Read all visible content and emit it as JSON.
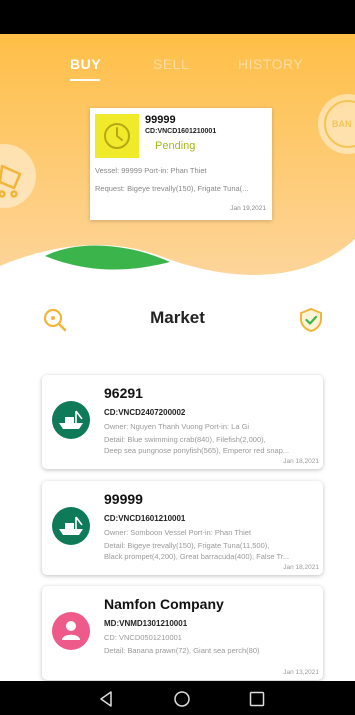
{
  "tabs": [
    {
      "label": "BUY"
    },
    {
      "label": "SELL"
    },
    {
      "label": "HISTORY"
    }
  ],
  "colors": {
    "gradient_top": "#ffc04a",
    "gradient_bottom": "#fdd28a",
    "accent_green": "#3cb44c",
    "pending_yellow": "#f1ea2a",
    "status_text": "#a6b81a",
    "icon_orange": "#f3b43a",
    "vessel_avatar": "#0e7a57",
    "company_avatar": "#ee5a8a"
  },
  "order": {
    "title": "99999",
    "code": "CD:VNCD1601210001",
    "status": "Pending",
    "vessel": "Vessel: 99999  Port-in: Phan Thiet",
    "request": "Request: Bigeye trevally(150), Frigate Tuna(...",
    "date": "Jan 19,2021",
    "icon": "clock-icon"
  },
  "side_badge_right": {
    "text": "BAN"
  },
  "market": {
    "title": "Market",
    "search_icon": "search-icon",
    "shield_icon": "shield-check-icon"
  },
  "listings": [
    {
      "title": "96291",
      "code": "CD:VNCD2407200002",
      "line1": "Owner: Nguyen Thanh Vuong  Port-in: La Gi",
      "line2": "Detail: Blue swimming crab(840), Filefish(2,000),",
      "line3": "Deep sea pungnose ponyfish(565), Emperor red snap...",
      "date": "Jan 18,2021",
      "icon": "vessel-icon"
    },
    {
      "title": "99999",
      "code": "CD:VNCD1601210001",
      "line1": "Owner: Somboon Vessel  Port-in: Phan Thiet",
      "line2": "Detail: Bigeye trevally(150), Frigate Tuna(11,500),",
      "line3": "Black prompet(4,200), Great barracuda(400), False Tr...",
      "date": "Jan 18,2021",
      "icon": "vessel-icon"
    },
    {
      "title": "Namfon Company",
      "code": "MD:VNMD1301210001",
      "line1": "CD: VNCD0501210001",
      "line2": "Detail: Banana prawn(72), Giant sea perch(80)",
      "line3": "",
      "date": "Jan 13,2021",
      "icon": "person-icon"
    }
  ],
  "nav": [
    "back-icon",
    "home-icon",
    "recents-icon"
  ]
}
